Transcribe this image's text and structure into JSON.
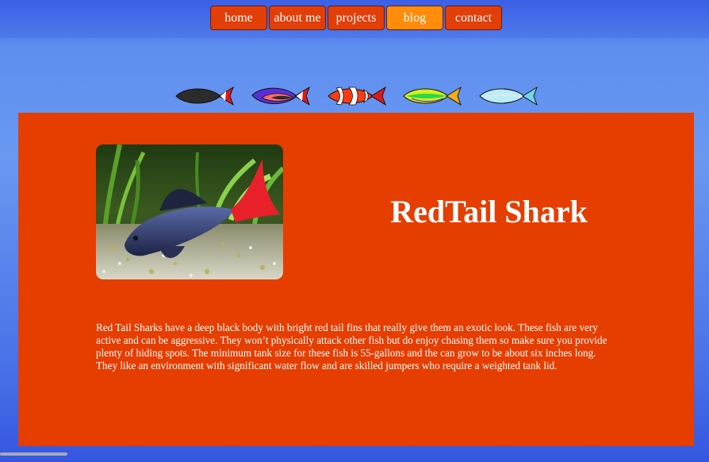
{
  "nav": {
    "items": [
      {
        "label": "home",
        "name": "nav-home"
      },
      {
        "label": "about me",
        "name": "nav-about-me"
      },
      {
        "label": "projects",
        "name": "nav-projects"
      },
      {
        "label": "blog",
        "name": "nav-blog",
        "active": true
      },
      {
        "label": "contact",
        "name": "nav-contact"
      }
    ]
  },
  "fish_icons": [
    {
      "name": "black-fish-icon",
      "body": "#2b2b2b",
      "tail": "#e11818"
    },
    {
      "name": "purple-fish-icon",
      "body": "#5a2fd6",
      "tail": "#e11818",
      "stripe": "#ff6a6a"
    },
    {
      "name": "clownfish-icon",
      "body": "#ff3a10",
      "tail": "#e11818",
      "stripe": "#ffffff"
    },
    {
      "name": "green-yellow-fish-icon",
      "body": "#d6f01a",
      "tail": "#f0b010",
      "stripe": "#2ad84a"
    },
    {
      "name": "light-blue-fish-icon",
      "body": "#b8eef8",
      "tail": "#6fd6ea"
    }
  ],
  "article": {
    "title": "RedTail Shark",
    "image_alt": "red tail shark photo",
    "description": "Red Tail Sharks have a deep black body with bright red tail fins that really give them an exotic look. These fish are very active and can be aggressive. They won’t physically attack other fish but do enjoy chasing them so make sure you provide plenty of hiding spots. The minimum tank size for these fish is 55-gallons and the can grow to be about six inches long. They like an environment with significant water flow and are skilled jumpers who require a weighted tank lid."
  },
  "colors": {
    "panel": "#e53e00",
    "nav_button": "#e23e08",
    "nav_active": "#ff8c0b",
    "page_background": "#5f8ef0"
  }
}
